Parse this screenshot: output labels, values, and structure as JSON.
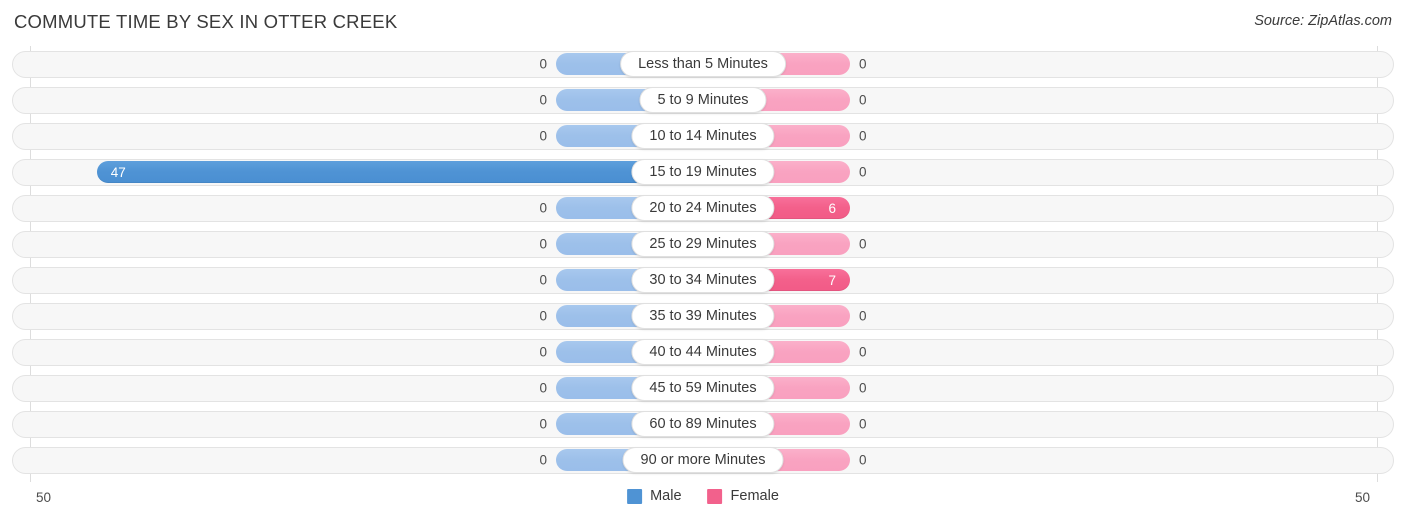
{
  "header": {
    "title": "COMMUTE TIME BY SEX IN OTTER CREEK",
    "source": "Source: ZipAtlas.com"
  },
  "axis": {
    "left_label": "50",
    "right_label": "50"
  },
  "legend": {
    "items": [
      {
        "label": "Male",
        "color": "#4f93d4",
        "icon": "legend-swatch-male"
      },
      {
        "label": "Female",
        "color": "#f2618c",
        "icon": "legend-swatch-female"
      }
    ]
  },
  "chart_data": {
    "type": "bar",
    "orientation": "horizontal",
    "layout": "diverging-bidirectional",
    "title": "COMMUTE TIME BY SEX IN OTTER CREEK",
    "xlabel": "",
    "ylabel": "",
    "xlim": [
      50,
      50
    ],
    "axis_max_left": 50,
    "axis_max_right": 50,
    "grid": true,
    "legend_position": "bottom-center",
    "categories": [
      "Less than 5 Minutes",
      "5 to 9 Minutes",
      "10 to 14 Minutes",
      "15 to 19 Minutes",
      "20 to 24 Minutes",
      "25 to 29 Minutes",
      "30 to 34 Minutes",
      "35 to 39 Minutes",
      "40 to 44 Minutes",
      "45 to 59 Minutes",
      "60 to 89 Minutes",
      "90 or more Minutes"
    ],
    "series": [
      {
        "name": "Male",
        "values": [
          0,
          0,
          0,
          47,
          0,
          0,
          0,
          0,
          0,
          0,
          0,
          0
        ]
      },
      {
        "name": "Female",
        "values": [
          0,
          0,
          0,
          0,
          6,
          0,
          7,
          0,
          0,
          0,
          0,
          0
        ]
      }
    ]
  },
  "rows": [
    {
      "category": "Less than 5 Minutes",
      "male": "0",
      "female": "0"
    },
    {
      "category": "5 to 9 Minutes",
      "male": "0",
      "female": "0"
    },
    {
      "category": "10 to 14 Minutes",
      "male": "0",
      "female": "0"
    },
    {
      "category": "15 to 19 Minutes",
      "male": "47",
      "female": "0"
    },
    {
      "category": "20 to 24 Minutes",
      "male": "0",
      "female": "6"
    },
    {
      "category": "25 to 29 Minutes",
      "male": "0",
      "female": "0"
    },
    {
      "category": "30 to 34 Minutes",
      "male": "0",
      "female": "7"
    },
    {
      "category": "35 to 39 Minutes",
      "male": "0",
      "female": "0"
    },
    {
      "category": "40 to 44 Minutes",
      "male": "0",
      "female": "0"
    },
    {
      "category": "45 to 59 Minutes",
      "male": "0",
      "female": "0"
    },
    {
      "category": "60 to 89 Minutes",
      "male": "0",
      "female": "0"
    },
    {
      "category": "90 or more Minutes",
      "male": "0",
      "female": "0"
    }
  ]
}
